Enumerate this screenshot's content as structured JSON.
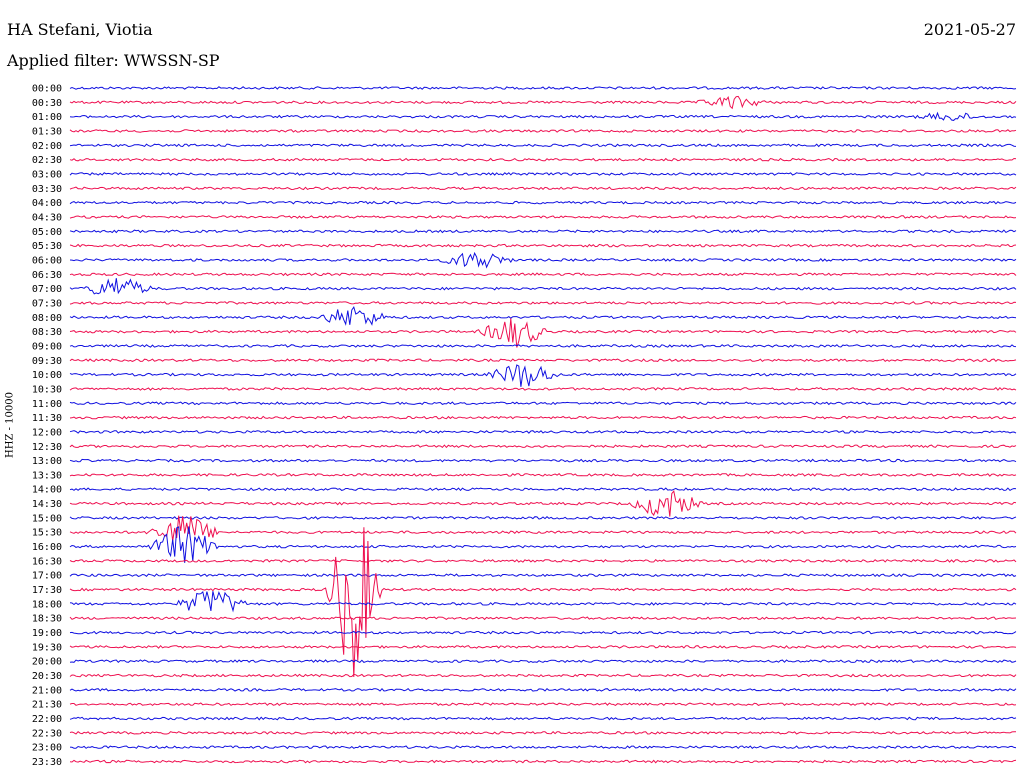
{
  "header": {
    "station": "HA Stefani, Viotia",
    "date": "2021-05-27",
    "filter": "Applied filter: WWSSN-SP",
    "channel": "HHZ - 10000"
  },
  "colors": {
    "blue": "#1010e0",
    "red": "#ee1050"
  },
  "chart_data": {
    "type": "line",
    "title": "HA Stefani, Viotia",
    "subtitle": "Applied filter: WWSSN-SP",
    "ylabel": "HHZ - 10000",
    "y_tick_labels": [
      "00:00",
      "00:30",
      "01:00",
      "01:30",
      "02:00",
      "02:30",
      "03:00",
      "03:30",
      "04:00",
      "04:30",
      "05:00",
      "05:30",
      "06:00",
      "06:30",
      "07:00",
      "07:30",
      "08:00",
      "08:30",
      "09:00",
      "09:30",
      "10:00",
      "10:30",
      "11:00",
      "11:30",
      "12:00",
      "12:30",
      "13:00",
      "13:30",
      "14:00",
      "14:30",
      "15:00",
      "15:30",
      "16:00",
      "16:30",
      "17:00",
      "17:30",
      "18:00",
      "18:30",
      "19:00",
      "19:30",
      "20:00",
      "20:30",
      "21:00",
      "21:30",
      "22:00",
      "22:30",
      "23:00",
      "23:30"
    ],
    "trace_colors": [
      "blue",
      "red"
    ],
    "events": [
      {
        "row": "01:00",
        "at": 0.93,
        "amplitude": 4
      },
      {
        "row": "00:30",
        "at": 0.7,
        "amplitude": 6
      },
      {
        "row": "06:00",
        "at": 0.43,
        "amplitude": 10
      },
      {
        "row": "07:00",
        "at": 0.05,
        "amplitude": 12
      },
      {
        "row": "08:00",
        "at": 0.3,
        "amplitude": 12
      },
      {
        "row": "08:30",
        "at": 0.47,
        "amplitude": 16
      },
      {
        "row": "10:00",
        "at": 0.48,
        "amplitude": 14
      },
      {
        "row": "14:30",
        "at": 0.63,
        "amplitude": 16
      },
      {
        "row": "15:30",
        "at": 0.12,
        "amplitude": 20
      },
      {
        "row": "16:00",
        "at": 0.12,
        "amplitude": 22
      },
      {
        "row": "17:30",
        "at": 0.3,
        "amplitude": 100
      },
      {
        "row": "18:00",
        "at": 0.15,
        "amplitude": 16
      }
    ]
  }
}
